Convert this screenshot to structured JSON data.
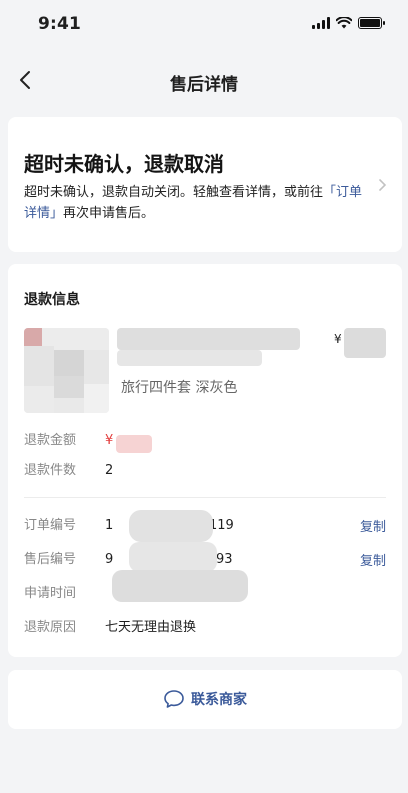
{
  "status_bar": {
    "time": "9:41"
  },
  "nav": {
    "title": "售后详情",
    "back_icon": "chevron-left-icon"
  },
  "status_card": {
    "title": "超时未确认，退款取消",
    "desc_before": "超时未确认，退款自动关闭。轻触查看详情，或前往",
    "desc_link": "「订单详情」",
    "desc_after": "再次申请售后。"
  },
  "refund": {
    "section_title": "退款信息",
    "product": {
      "spec": "旅行四件套 深灰色",
      "price_prefix": "¥"
    },
    "amount": {
      "label": "退款金额",
      "value": "¥"
    },
    "quantity": {
      "label": "退款件数",
      "value": "2"
    },
    "order_no": {
      "label": "订单编号",
      "value_start": "1",
      "value_end": "119",
      "copy": "复制"
    },
    "aftersale_no": {
      "label": "售后编号",
      "value_start": "9",
      "value_end": "93",
      "copy": "复制"
    },
    "apply_time": {
      "label": "申请时间"
    },
    "reason": {
      "label": "退款原因",
      "value": "七天无理由退换"
    }
  },
  "contact": {
    "label": "联系商家",
    "icon": "chat-bubble-icon"
  },
  "colors": {
    "accent": "#3b5a9a",
    "price_red": "#e23b3b",
    "background": "#f3f4f6"
  }
}
